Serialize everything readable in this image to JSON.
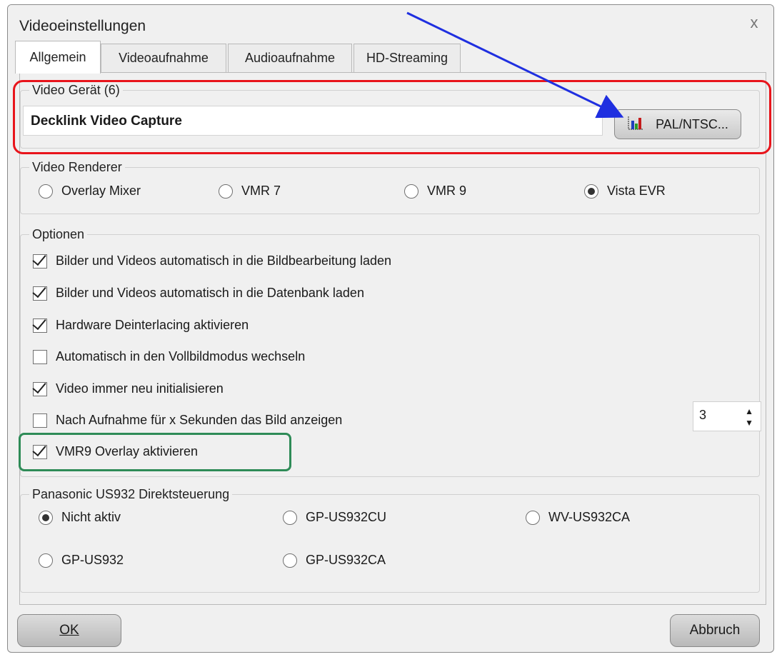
{
  "window": {
    "title": "Videoeinstellungen",
    "close_glyph": "x"
  },
  "tabs": [
    {
      "label": "Allgemein",
      "active": true
    },
    {
      "label": "Videoaufnahme",
      "active": false
    },
    {
      "label": "Audioaufnahme",
      "active": false
    },
    {
      "label": "HD-Streaming",
      "active": false
    }
  ],
  "video_device": {
    "legend": "Video Gerät (6)",
    "value": "Decklink Video Capture",
    "button_label": "PAL/NTSC...",
    "button_icon": "bar-chart-icon"
  },
  "video_renderer": {
    "legend": "Video Renderer",
    "options": [
      {
        "label": "Overlay Mixer",
        "selected": false
      },
      {
        "label": "VMR 7",
        "selected": false
      },
      {
        "label": "VMR 9",
        "selected": false
      },
      {
        "label": "Vista EVR",
        "selected": true
      }
    ]
  },
  "options": {
    "legend": "Optionen",
    "checks": [
      {
        "label": "Bilder und Videos automatisch in die Bildbearbeitung laden",
        "checked": true
      },
      {
        "label": "Bilder und Videos automatisch in die Datenbank laden",
        "checked": true
      },
      {
        "label": "Hardware Deinterlacing aktivieren",
        "checked": true
      },
      {
        "label": "Automatisch in den Vollbildmodus wechseln",
        "checked": false
      },
      {
        "label": "Video immer neu initialisieren",
        "checked": true
      },
      {
        "label": "Nach Aufnahme für x Sekunden das Bild anzeigen",
        "checked": false
      },
      {
        "label": "VMR9 Overlay aktivieren",
        "checked": true
      }
    ],
    "seconds_value": "3"
  },
  "panasonic": {
    "legend": "Panasonic US932 Direktsteuerung",
    "options": [
      {
        "label": "Nicht aktiv",
        "selected": true
      },
      {
        "label": "GP-US932CU",
        "selected": false
      },
      {
        "label": "WV-US932CA",
        "selected": false
      },
      {
        "label": "GP-US932",
        "selected": false
      },
      {
        "label": "GP-US932CA",
        "selected": false
      }
    ]
  },
  "footer": {
    "ok_label": "OK",
    "cancel_label": "Abbruch"
  },
  "annotations": {
    "red_box_color": "#e8141b",
    "green_box_color": "#2e8b57",
    "arrow_color": "#1f2fe0"
  }
}
